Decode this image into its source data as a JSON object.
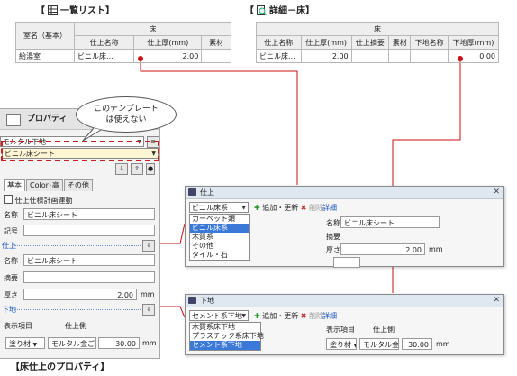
{
  "top_left": {
    "caption_open": "【",
    "caption_text": "一覧リスト",
    "caption_close": "】",
    "caption_icon": "table-list-icon",
    "table": {
      "group_header": "床",
      "row_label_header": "室名（基本）",
      "columns": [
        "仕上名称",
        "仕上厚(mm)",
        "素材"
      ],
      "rows": [
        {
          "room": "給湯室",
          "name": "ビニル床...",
          "thickness": "2.00",
          "material": ""
        }
      ]
    }
  },
  "top_right": {
    "caption_open": "【",
    "caption_text": "詳細－床",
    "caption_close": "】",
    "caption_icon": "magnifier-detail-icon",
    "table": {
      "group_header": "床",
      "columns": [
        "仕上名称",
        "仕上厚(mm)",
        "仕上摘要",
        "素材",
        "下地名称",
        "下地厚(mm)"
      ],
      "rows": [
        {
          "name": "ビニル床...",
          "thickness": "2.00",
          "summary": "",
          "material": "",
          "base_name": "",
          "base_thickness": "0.00"
        }
      ]
    }
  },
  "callout": {
    "line1": "このテンプレート",
    "line2": "は使えない"
  },
  "property_panel": {
    "title": "プロパティ",
    "icon": "properties-icon",
    "template_combo": "モルタル下地",
    "selected_combo": "ビニル床シート",
    "tabs": [
      "基本",
      "Color･高",
      "その他"
    ],
    "checkbox_label": "仕上仕様計画連動",
    "name_label": "名称",
    "name_value": "ビニル床シート",
    "symbol_label": "記号",
    "symbol_value": "",
    "finish_section": "仕上",
    "finish_name_label": "名称",
    "finish_name_value": "ビニル床シート",
    "summary_label": "摘要",
    "summary_value": "",
    "thickness_label": "厚さ",
    "thickness_value": "2.00",
    "thickness_unit": "mm",
    "base_section": "下地",
    "display_item_label": "表示項目",
    "side_label": "仕上側",
    "paint_combo": "塗り材",
    "base_combo": "モルタル金ごて",
    "base_thickness": "30.00",
    "base_unit": "mm"
  },
  "bottom_caption": "【床仕上のプロパティ】",
  "finish_dialog": {
    "title": "仕上",
    "combo": "ビニル床系",
    "toolbar_add": "追加・更新",
    "toolbar_delete": "削除",
    "detail_label": "詳細",
    "options": [
      "カーペット類",
      "ビニル床系",
      "木質系",
      "その他",
      "タイル・石"
    ],
    "selected_index": 1,
    "name_label": "名称",
    "name_value": "ビニル床シート",
    "summary_label": "摘要",
    "thickness_label": "厚さ",
    "thickness_value": "2.00",
    "unit": "mm"
  },
  "base_dialog": {
    "title": "下地",
    "combo": "セメント系下地",
    "toolbar_add": "追加・更新",
    "toolbar_delete": "削除",
    "detail_label": "詳細",
    "options": [
      "木質系床下地",
      "プラスチック系床下地",
      "セメント系下地"
    ],
    "selected_index": 2,
    "display_item_label": "表示項目",
    "side_label": "仕上側",
    "paint_combo": "塗り材",
    "base_combo": "モルタル金ご",
    "base_thickness": "30.00",
    "unit": "mm"
  },
  "colors": {
    "accent_red": "#cc1010",
    "selection_blue": "#3a79d8",
    "section_blue": "#1a55c0"
  }
}
